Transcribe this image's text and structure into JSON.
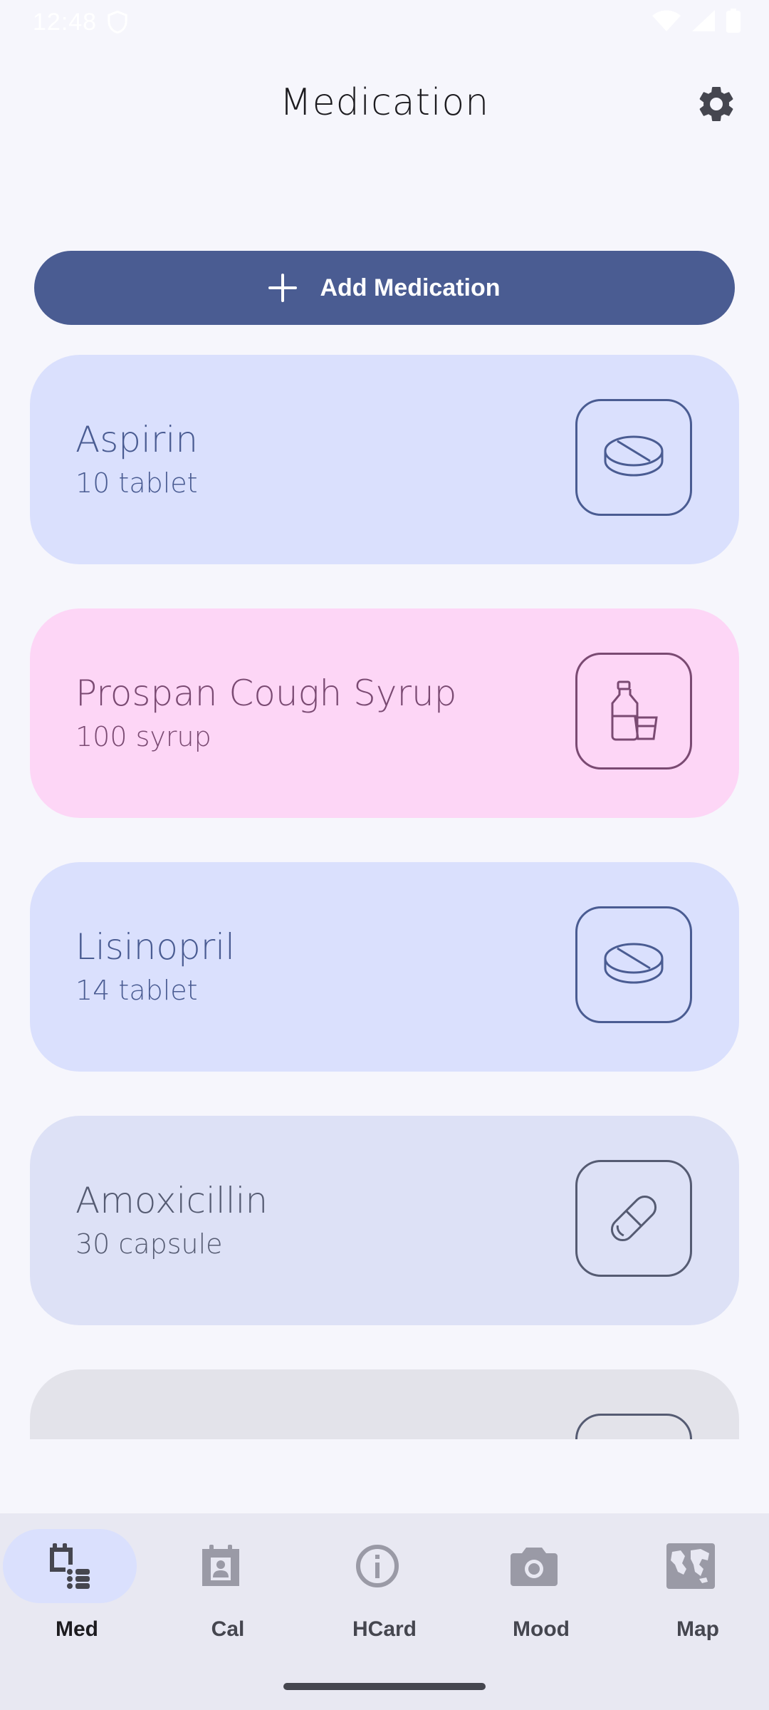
{
  "status_bar": {
    "time": "12:48"
  },
  "header": {
    "title": "Medication"
  },
  "actions": {
    "add_label": "Add Medication"
  },
  "medications": [
    {
      "name": "Aspirin",
      "amount": "10 tablet",
      "icon": "tablet-icon",
      "card_color": "#dae0fd",
      "text_color": "#4a5c92"
    },
    {
      "name": "Prospan Cough Syrup",
      "amount": "100 syrup",
      "icon": "syrup-icon",
      "card_color": "#fdd6f6",
      "text_color": "#7a4a72"
    },
    {
      "name": "Lisinopril",
      "amount": "14 tablet",
      "icon": "tablet-icon",
      "card_color": "#dae0fd",
      "text_color": "#4a5c92"
    },
    {
      "name": "Amoxicillin",
      "amount": "30 capsule",
      "icon": "capsule-icon",
      "card_color": "#dde1f6",
      "text_color": "#555b72"
    },
    {
      "name": "",
      "amount": "",
      "icon": "tablet-icon",
      "card_color": "#e3e3ea",
      "text_color": "#555b72"
    }
  ],
  "bottom_nav": [
    {
      "label": "Med",
      "icon": "medication-list-icon",
      "active": true
    },
    {
      "label": "Cal",
      "icon": "calendar-icon",
      "active": false
    },
    {
      "label": "HCard",
      "icon": "info-icon",
      "active": false
    },
    {
      "label": "Mood",
      "icon": "camera-icon",
      "active": false
    },
    {
      "label": "Map",
      "icon": "map-icon",
      "active": false
    }
  ],
  "colors": {
    "primary": "#4a5c92",
    "background": "#f6f6fc",
    "nav_background": "#e8e8f2",
    "nav_active_pill": "#dae0fd"
  }
}
